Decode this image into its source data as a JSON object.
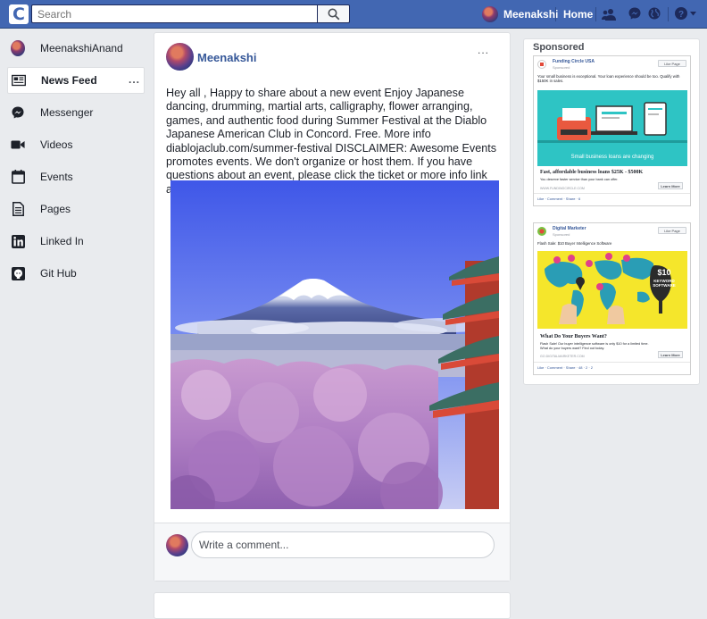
{
  "topbar": {
    "logo_letter": "C",
    "search_placeholder": "Search",
    "profile_name": "Meenakshi",
    "home_label": "Home"
  },
  "left_nav": {
    "items": [
      {
        "label": "MeenakshiAnand",
        "icon": "avatar"
      },
      {
        "label": "News Feed",
        "icon": "newspaper-icon",
        "more": "..."
      },
      {
        "label": "Messenger",
        "icon": "messenger-icon"
      },
      {
        "label": "Videos",
        "icon": "video-camera-icon"
      },
      {
        "label": "Events",
        "icon": "calendar-icon"
      },
      {
        "label": "Pages",
        "icon": "document-icon"
      },
      {
        "label": "Linked In",
        "icon": "linkedin-icon"
      },
      {
        "label": "Git Hub",
        "icon": "github-icon"
      }
    ]
  },
  "post": {
    "author": "Meenakshi",
    "menu": "...",
    "text": "Hey all ,  Happy to share about a new event   Enjoy Japanese dancing, drumming, martial arts, calligraphy, flower arranging, games, and authentic food during Summer Festival at the Diablo Japanese American Club in Concord. Free.  More info diablojaclub.com/summer-festival  DISCLAIMER: Awesome Events promotes events. We don't organize or host them. If you have questions about an event, please click the ticket or more info link and ask the organizers. Thank you and have a nice day.",
    "comment_placeholder": "Write a comment..."
  },
  "sponsored": {
    "title": "Sponsored",
    "ads": [
      {
        "advertiser": "Funding Circle USA",
        "sub": "Sponsored",
        "like_label": "Like Page",
        "body": "Your small business is exceptional. Your loan experience should be too. Qualify with $150K in sales.",
        "banner_text": "Small business loans are changing",
        "headline": "Fast, affordable business loans $25K - $500K",
        "description": "You deserve faster service than your bank can offer.",
        "url": "WWW.FUNDINGCIRCLE.COM",
        "cta": "Learn More",
        "actions": "Like · Comment · Share · 6",
        "accent": "#2ec4c4"
      },
      {
        "advertiser": "Digital Marketer",
        "sub": "Sponsored",
        "like_label": "Like Page",
        "body": "Flash Sale: $10 Buyer Intelligence Software",
        "banner_price": "$10",
        "banner_line1": "KEYWORD",
        "banner_line2": "SOFTWARE",
        "headline": "What Do Your Buyers Want?",
        "description": "Flash Sale! Our buyer intelligence software is only $10 for a limited time. What do your buyers want? Find out today.",
        "url": "GO.DIGITALMARKETER.COM",
        "cta": "Learn More",
        "actions": "Like · Comment · Share · 48 · 2 · 2",
        "accent": "#f5e62b"
      }
    ]
  }
}
